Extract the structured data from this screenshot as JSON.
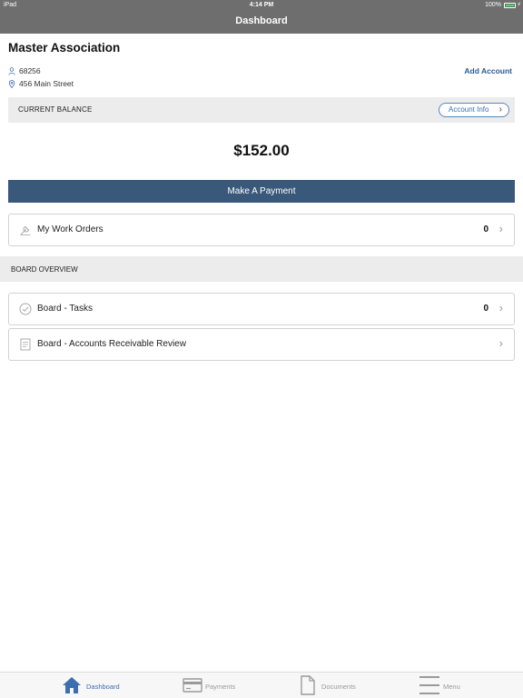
{
  "status_bar": {
    "carrier": "iPad",
    "time": "4:14 PM",
    "battery": "100%"
  },
  "nav": {
    "title": "Dashboard"
  },
  "account": {
    "name": "Master Association",
    "id": "68256",
    "address": "456 Main Street",
    "add_account": "Add Account"
  },
  "balance": {
    "label": "CURRENT BALANCE",
    "account_info": "Account Info",
    "amount": "$152.00"
  },
  "payment": {
    "button": "Make A Payment"
  },
  "work_orders": {
    "label": "My Work Orders",
    "count": "0"
  },
  "board": {
    "header": "BOARD OVERVIEW",
    "tasks": {
      "label": "Board - Tasks",
      "count": "0"
    },
    "ar_review": {
      "label": "Board - Accounts Receivable Review"
    }
  },
  "tabs": [
    {
      "label": "Dashboard"
    },
    {
      "label": "Payments"
    },
    {
      "label": "Documents"
    },
    {
      "label": "Menu"
    }
  ],
  "colors": {
    "accent": "#3a587a",
    "active_tab": "#3c6eb0",
    "inactive_tab": "#9a9a9a",
    "header_bg": "#6e6e6e"
  }
}
